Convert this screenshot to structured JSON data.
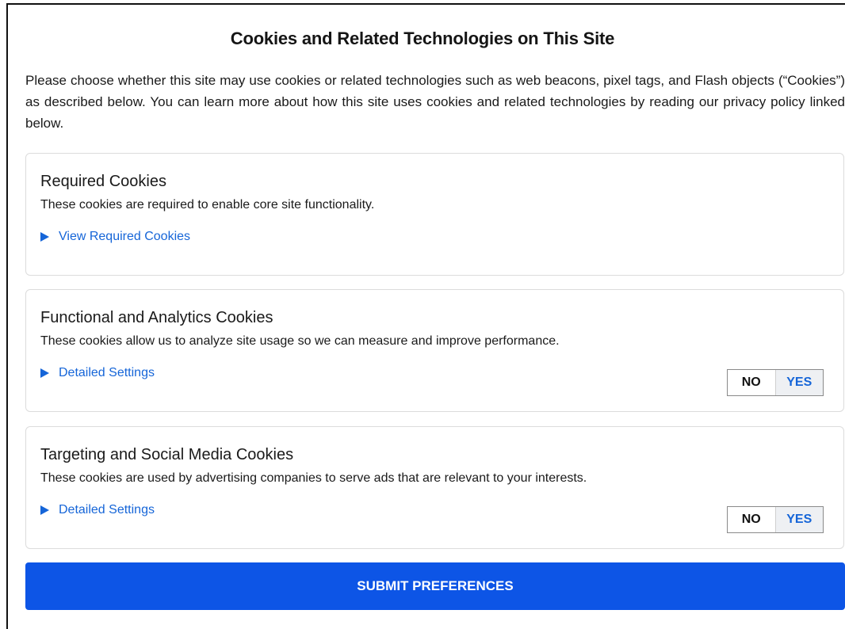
{
  "dialog": {
    "title": "Cookies and Related Technologies on This Site",
    "intro": "Please choose whether this site may use cookies or related technologies such as web beacons, pixel tags, and Flash objects (“Cookies”) as described below. You can learn more about how this site uses cookies and related technologies by reading our privacy policy linked below."
  },
  "sections": [
    {
      "title": "Required Cookies",
      "description": "These cookies are required to enable core site functionality.",
      "link": "View Required Cookies"
    },
    {
      "title": "Functional and Analytics Cookies",
      "description": "These cookies allow us to analyze site usage so we can measure and improve performance.",
      "link": "Detailed Settings",
      "toggle": {
        "no": "NO",
        "yes": "YES",
        "selected": "YES"
      }
    },
    {
      "title": "Targeting and Social Media Cookies",
      "description": "These cookies are used by advertising companies to serve ads that are relevant to your interests.",
      "link": "Detailed Settings",
      "toggle": {
        "no": "NO",
        "yes": "YES",
        "selected": "YES"
      }
    }
  ],
  "submit_label": "SUBMIT PREFERENCES",
  "colors": {
    "accent": "#0d55e6",
    "link": "#1565d8"
  },
  "icons": {
    "expand": "triangle-right-icon"
  }
}
